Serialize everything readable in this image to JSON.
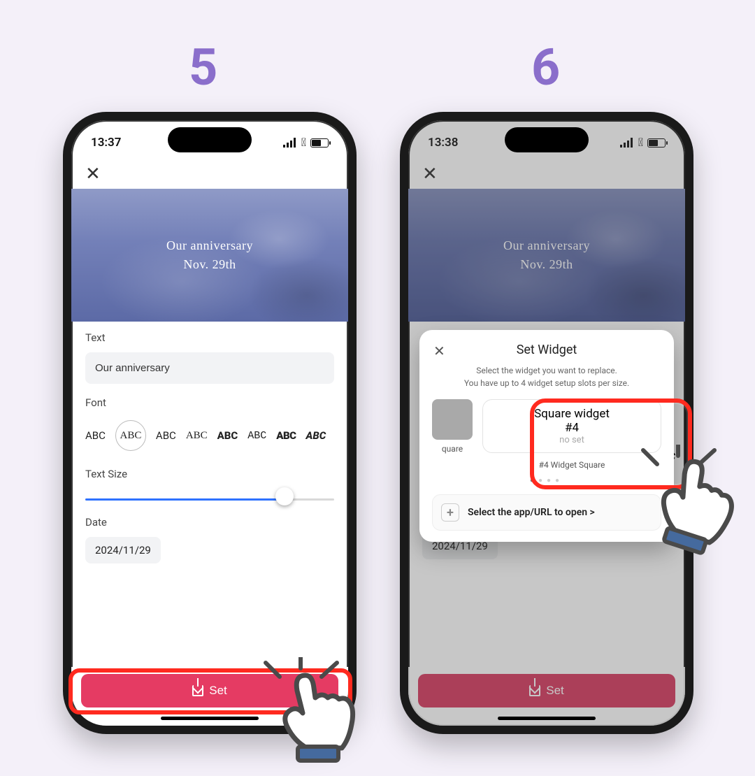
{
  "steps": {
    "left": "5",
    "right": "6"
  },
  "status": {
    "time_left": "13:37",
    "time_right": "13:38"
  },
  "hero": {
    "line1": "Our anniversary",
    "line2": "Nov. 29th"
  },
  "labels": {
    "text": "Text",
    "font": "Font",
    "text_size": "Text Size",
    "date": "Date",
    "set": "Set"
  },
  "text_input": "Our anniversary",
  "fonts": [
    "ABC",
    "ABC",
    "ABC",
    "ABC",
    "ABC",
    "ABC",
    "ABC",
    "ABC"
  ],
  "date_value": "2024/11/29",
  "sheet": {
    "title": "Set Widget",
    "sub1": "Select the widget you want to replace.",
    "sub2": "You have up to 4 widget setup slots per size.",
    "thumb_caption": "quare",
    "card_title1": "Square widget",
    "card_title2": "#4",
    "card_sub": "no set",
    "card_caption": "#4 Widget Square",
    "open_row": "Select the app/URL to open >"
  },
  "overflow_abc": "ABC"
}
